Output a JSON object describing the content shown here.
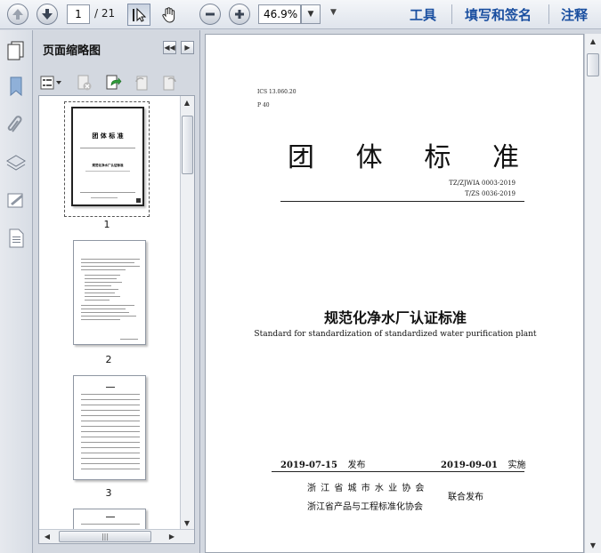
{
  "toolbar": {
    "page_current": "1",
    "page_total": "/ 21",
    "zoom": "46.9%",
    "links": [
      "工具",
      "填写和签名",
      "注释"
    ]
  },
  "icons": {
    "prev_page": "arrow-up-icon",
    "next_page": "arrow-down-icon",
    "select_tool": "cursor-icon",
    "hand_tool": "hand-icon",
    "zoom_out": "minus-icon",
    "zoom_in": "plus-icon"
  },
  "panel": {
    "title": "页面缩略图",
    "pages": [
      "1",
      "2",
      "3"
    ]
  },
  "document": {
    "ics": "ICS 13.060.20",
    "ccs": "P 40",
    "title_chars": [
      "团",
      "体",
      "标",
      "准"
    ],
    "std_no_1": "TZ/ZJWIA  0003-2019",
    "std_no_2": "T/ZS 0036-2019",
    "main_title": "规范化净水厂认证标准",
    "sub_title": "Standard for standardization of standardized water purification plant",
    "publish_date": "2019-07-15",
    "publish_label": "发布",
    "implement_date": "2019-09-01",
    "implement_label": "实施",
    "org_1": "浙 江 省 城 市 水 业 协 会",
    "org_2": "浙江省产品与工程标准化协会",
    "joint": "联合发布"
  },
  "thumb1": {
    "title": "团    体    标    准",
    "subtitle": "规范化净水厂认证标准"
  },
  "colors": {
    "link_blue": "#1a4fa0",
    "toolbar_bg": "#e6eaf0",
    "panel_bg": "#d3d8e0"
  }
}
